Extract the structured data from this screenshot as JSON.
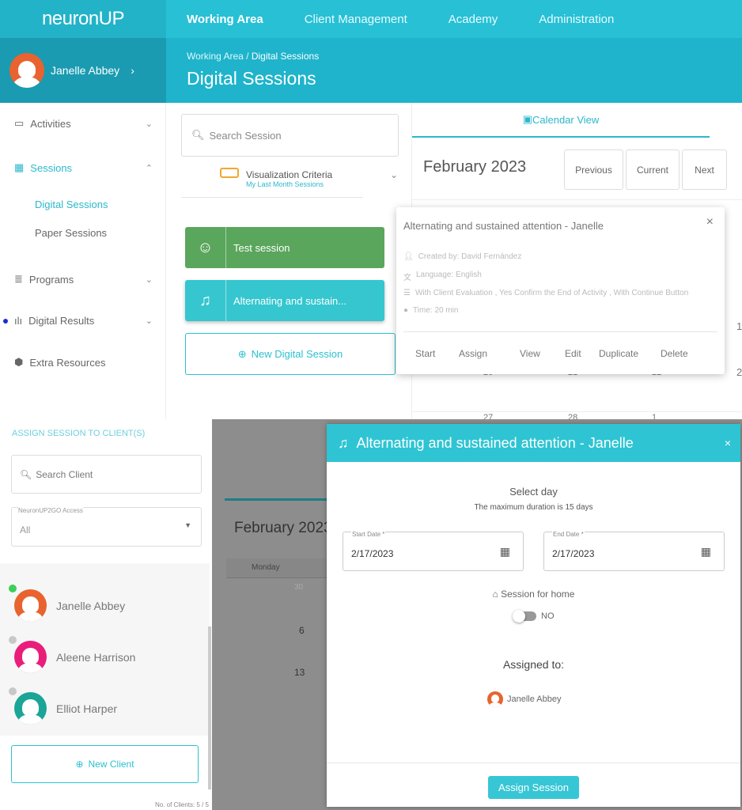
{
  "header": {
    "logo": "neuronUP",
    "nav": [
      "Working Area",
      "Client Management",
      "Academy",
      "Administration"
    ]
  },
  "user": {
    "name": "Janelle Abbey"
  },
  "breadcrumb": [
    "Working Area",
    "Digital Sessions"
  ],
  "page_title": "Digital Sessions",
  "sidebar": {
    "items": [
      {
        "label": "Activities",
        "icon": "monitor-icon"
      },
      {
        "label": "Sessions",
        "icon": "grid-icon",
        "active": true
      },
      {
        "label": "Programs",
        "icon": "list-icon"
      },
      {
        "label": "Digital Results",
        "icon": "bar-chart-icon"
      },
      {
        "label": "Extra Resources",
        "icon": "box-icon"
      }
    ],
    "subitems": [
      "Digital Sessions",
      "Paper Sessions"
    ]
  },
  "sessions": {
    "search_placeholder": "Search Session",
    "criteria_label": "Visualization Criteria",
    "criteria_value": "My Last Month Sessions",
    "cards": [
      {
        "label": "Test session",
        "color": "#5aa65c"
      },
      {
        "label": "Alternating and sustain...",
        "color": "#35c6cf"
      }
    ],
    "new_button": "New Digital Session"
  },
  "calendar": {
    "tab": "Calendar View",
    "month": "February 2023",
    "buttons": [
      "Previous",
      "Current",
      "Next"
    ],
    "days": [
      "1",
      "2",
      "20",
      "21",
      "22",
      "27",
      "28",
      "1"
    ]
  },
  "popover": {
    "title": "Alternating and sustained attention - Janelle",
    "created_by": "Created by: David Fernández",
    "language": "Language: English",
    "options": "With Client Evaluation , Yes Confirm the End of Activity , With Continue Button",
    "time": "Time: 20 min",
    "actions": [
      "Start",
      "Assign",
      "View",
      "Edit",
      "Duplicate",
      "Delete"
    ]
  },
  "assign_panel": {
    "title": "ASSIGN SESSION TO CLIENT(S)",
    "search_placeholder": "Search Client",
    "access_label": "NeuronUP2GO Access",
    "access_value": "All",
    "clients": [
      {
        "name": "Janelle Abbey",
        "color": "#e8632f",
        "selected": true
      },
      {
        "name": "Aleene Harrison",
        "color": "#e91e7a",
        "selected": false
      },
      {
        "name": "Elliot Harper",
        "color": "#1aa596",
        "selected": false
      }
    ],
    "new_client": "New Client",
    "count": "No. of Clients: 5 / 5"
  },
  "background_calendar": {
    "month": "February 2023",
    "weekday": "Monday",
    "days": [
      "30",
      "6",
      "13"
    ]
  },
  "modal": {
    "title": "Alternating and sustained attention - Janelle",
    "select_day": "Select day",
    "max_duration": "The maximum duration is 15 days",
    "start_label": "Start Date *",
    "start_value": "2/17/2023",
    "end_label": "End Date *",
    "end_value": "2/17/2023",
    "home_label": "Session for home",
    "toggle_value": "NO",
    "assigned_label": "Assigned to:",
    "assigned_name": "Janelle Abbey",
    "submit": "Assign Session"
  },
  "colors": {
    "accent": "#27c0d5",
    "green": "#5aa65c"
  }
}
